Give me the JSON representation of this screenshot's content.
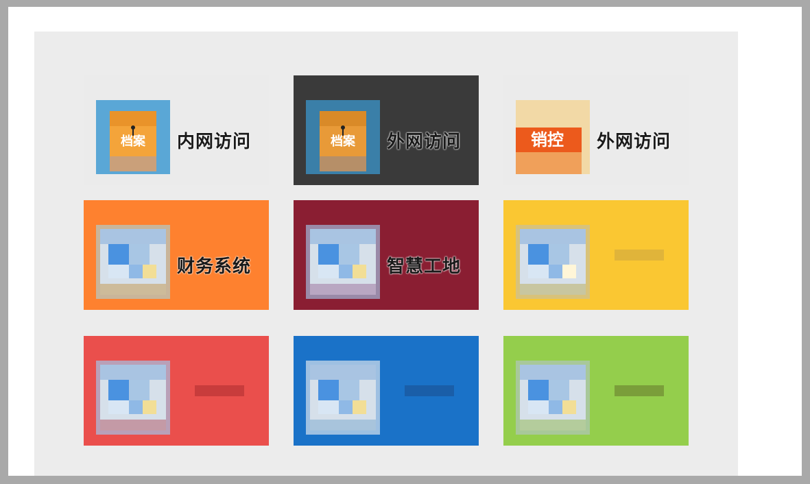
{
  "colors": {
    "page_border": "#a9a9a9",
    "panel": "#ececec",
    "tile_white": "#ebebeb",
    "tile_dark": "#3a3a3a",
    "tile_orange": "#fe812f",
    "tile_maroon": "#8a1e32",
    "tile_yellow": "#fac732",
    "tile_red": "#ea4f4c",
    "tile_blue": "#1a72c8",
    "tile_green": "#94ce4c"
  },
  "tiles": [
    {
      "label": "内网访问",
      "icon": "archive-icon",
      "icon_text": "档案"
    },
    {
      "label": "外网访问",
      "icon": "archive-icon",
      "icon_text": "档案"
    },
    {
      "label": "外网访问",
      "icon": "sales-control-icon",
      "icon_text": "销控"
    },
    {
      "label": "财务系统",
      "icon": "app-window-icon"
    },
    {
      "label": "智慧工地",
      "icon": "app-window-icon"
    },
    {
      "label": "",
      "icon": "app-window-icon"
    },
    {
      "label": "",
      "icon": "app-window-icon"
    },
    {
      "label": "",
      "icon": "app-window-icon"
    },
    {
      "label": "",
      "icon": "app-window-icon"
    }
  ]
}
